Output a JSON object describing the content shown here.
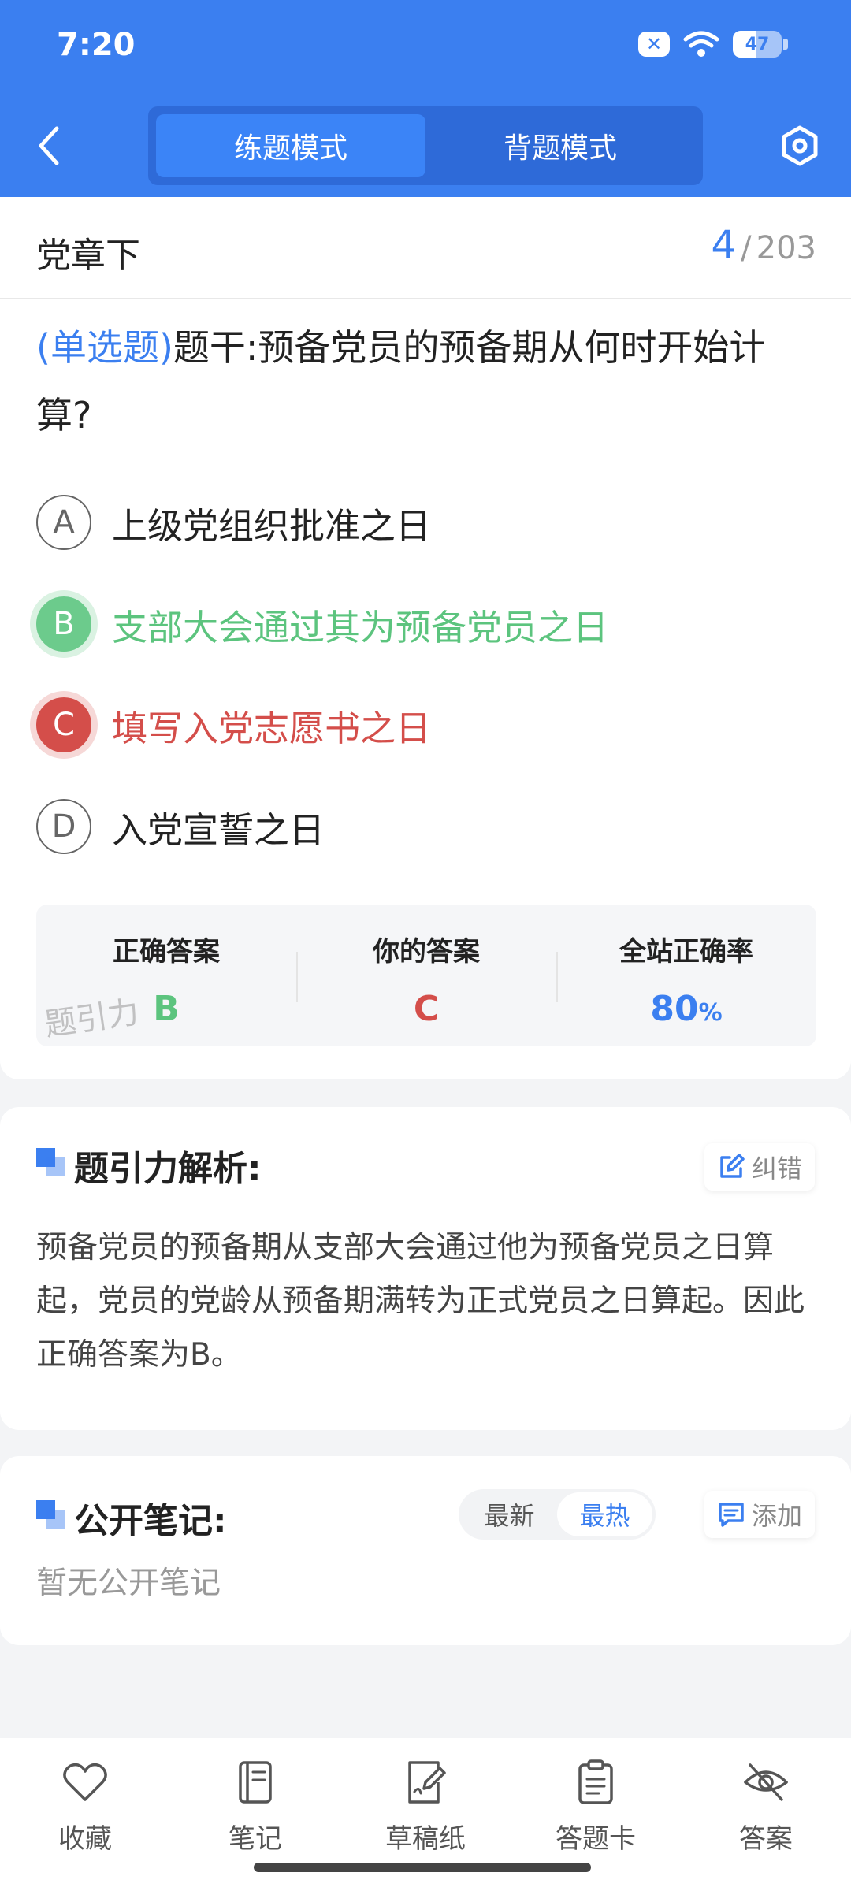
{
  "status_bar": {
    "time": "7:20",
    "battery_level": "47",
    "battery_fraction": 0.47
  },
  "header": {
    "tabs": [
      {
        "label": "练题模式",
        "active": true
      },
      {
        "label": "背题模式",
        "active": false
      }
    ]
  },
  "chapter": {
    "title": "党章下",
    "current": "4",
    "separator": "/",
    "total": "203"
  },
  "question": {
    "type": "(单选题)",
    "stem": "题干:预备党员的预备期从何时开始计算?",
    "options": [
      {
        "letter": "A",
        "text": "上级党组织批准之日",
        "state": "normal"
      },
      {
        "letter": "B",
        "text": "支部大会通过其为预备党员之日",
        "state": "correct"
      },
      {
        "letter": "C",
        "text": "填写入党志愿书之日",
        "state": "wrong"
      },
      {
        "letter": "D",
        "text": "入党宣誓之日",
        "state": "normal"
      }
    ]
  },
  "answer": {
    "correct_label": "正确答案",
    "correct_value": "B",
    "yours_label": "你的答案",
    "yours_value": "C",
    "rate_label": "全站正确率",
    "rate_value": "80",
    "rate_unit": "%",
    "watermark": "题引力"
  },
  "analysis": {
    "title": "题引力解析:",
    "correct_btn": "纠错",
    "text": "预备党员的预备期从支部大会通过他为预备党员之日算起，党员的党龄从预备期满转为正式党员之日算起。因此正确答案为B。"
  },
  "notes": {
    "title": "公开笔记:",
    "sort_latest": "最新",
    "sort_hot": "最热",
    "add_btn": "添加",
    "empty": "暂无公开笔记"
  },
  "bottom_nav": [
    {
      "label": "收藏",
      "icon": "heart-icon"
    },
    {
      "label": "笔记",
      "icon": "notebook-icon"
    },
    {
      "label": "草稿纸",
      "icon": "draft-icon"
    },
    {
      "label": "答题卡",
      "icon": "clipboard-icon"
    },
    {
      "label": "答案",
      "icon": "eye-off-icon"
    }
  ],
  "colors": {
    "primary": "#3b7ff0",
    "correct": "#5cc47e",
    "wrong": "#d44e4a"
  }
}
